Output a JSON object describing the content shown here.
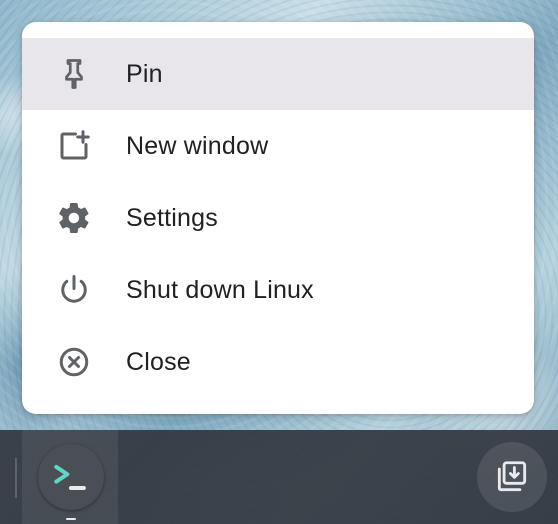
{
  "context_menu": {
    "items": [
      {
        "label": "Pin",
        "icon": "pin-icon",
        "highlighted": true
      },
      {
        "label": "New window",
        "icon": "new-window-icon",
        "highlighted": false
      },
      {
        "label": "Settings",
        "icon": "gear-icon",
        "highlighted": false
      },
      {
        "label": "Shut down Linux",
        "icon": "power-icon",
        "highlighted": false
      },
      {
        "label": "Close",
        "icon": "close-circle-icon",
        "highlighted": false
      }
    ]
  },
  "shelf": {
    "apps": [
      {
        "icon": "terminal-icon",
        "running": true
      }
    ],
    "tray": {
      "icon": "holding-space-icon"
    }
  },
  "colors": {
    "menu_background": "#ffffff",
    "menu_highlight": "#e8e6ea",
    "menu_text": "#202124",
    "menu_icon": "#5f6368",
    "shelf_background": "#32363e",
    "terminal_prompt": "#5fd7c4",
    "terminal_cursor": "#e8eaed"
  }
}
